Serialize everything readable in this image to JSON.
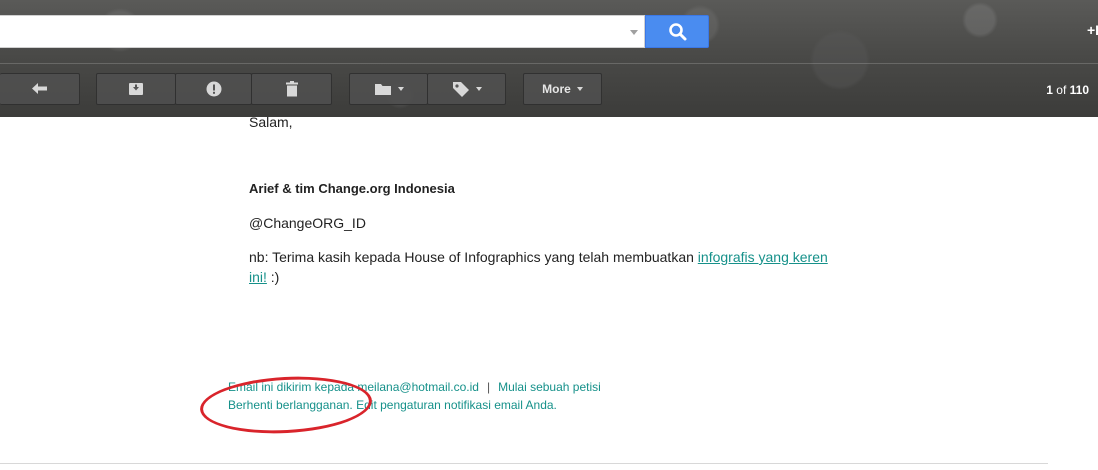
{
  "header": {
    "search": {
      "value": "",
      "placeholder": ""
    },
    "plus_link": "+I",
    "toolbar": {
      "more_label": "More"
    },
    "pager": {
      "current": "1",
      "of": "of",
      "total": "110"
    }
  },
  "email": {
    "greeting": "Salam,",
    "signature": "Arief & tim Change.org Indonesia",
    "handle": "@ChangeORG_ID",
    "note_text": "nb: Terima kasih kepada House of Infographics yang telah membuatkan ",
    "note_link_part1": "infografis yang keren",
    "note_link_part2": "ini!",
    "note_tail": " :)"
  },
  "footer": {
    "line1_text": "Email ini dikirim kepada meilana@hotmail.co.id",
    "separator": "|",
    "start_petition": "Mulai sebuah petisi",
    "unsubscribe": "Berhenti berlangganan.",
    "edit_settings": " Edit pengaturan notifikasi email Anda."
  },
  "colors": {
    "link": "#16918a",
    "search_button": "#4a8cf0",
    "annotation": "#d9242b"
  },
  "icons": [
    "search-icon",
    "reply-icon",
    "archive-icon",
    "report-spam-icon",
    "delete-icon",
    "folder-icon",
    "label-icon"
  ]
}
